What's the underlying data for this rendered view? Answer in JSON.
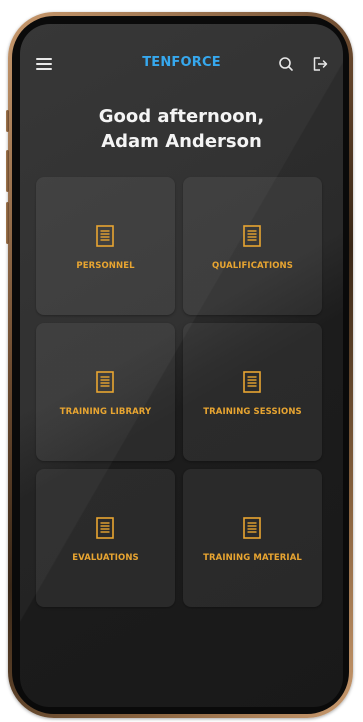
{
  "header": {
    "brand": "TENFORCE",
    "menu_icon": "hamburger-menu-icon",
    "search_icon": "search-icon",
    "logout_icon": "logout-icon"
  },
  "greeting": {
    "line1": "Good afternoon,",
    "line2": "Adam Anderson"
  },
  "tiles": [
    {
      "label": "PERSONNEL",
      "icon": "document-icon"
    },
    {
      "label": "QUALIFICATIONS",
      "icon": "document-icon"
    },
    {
      "label": "TRAINING LIBRARY",
      "icon": "document-icon"
    },
    {
      "label": "TRAINING SESSIONS",
      "icon": "document-icon"
    },
    {
      "label": "EVALUATIONS",
      "icon": "document-icon"
    },
    {
      "label": "TRAINING MATERIAL",
      "icon": "document-icon"
    }
  ],
  "colors": {
    "brand": "#36a8ee",
    "accent": "#e8a531",
    "screen_bg": "#2a2a2a",
    "frame": "#c99a6e"
  }
}
